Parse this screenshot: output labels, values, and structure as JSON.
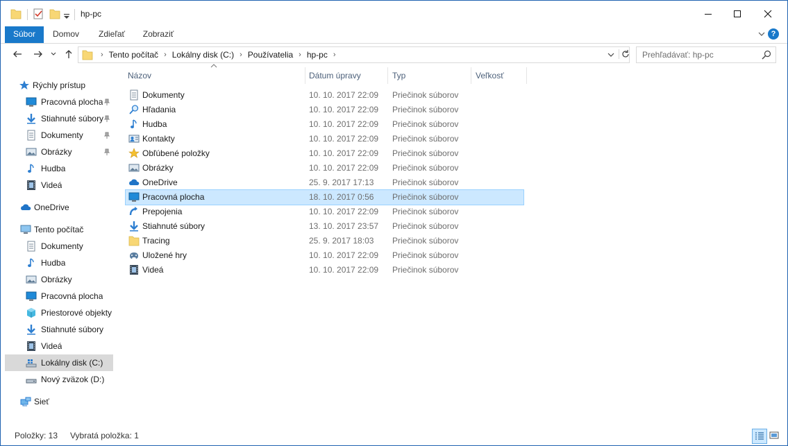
{
  "window": {
    "title": "hp-pc"
  },
  "ribbon": {
    "tabs": [
      {
        "label": "Súbor"
      },
      {
        "label": "Domov"
      },
      {
        "label": "Zdieľať"
      },
      {
        "label": "Zobraziť"
      }
    ]
  },
  "address": {
    "crumbs": [
      "Tento počítač",
      "Lokálny disk (C:)",
      "Používatelia",
      "hp-pc"
    ]
  },
  "search": {
    "placeholder": "Prehľadávať: hp-pc"
  },
  "nav": {
    "quick_access": "Rýchly prístup",
    "quick_items": [
      {
        "label": "Pracovná plocha",
        "icon": "desktop-icon"
      },
      {
        "label": "Stiahnuté súbory",
        "icon": "download-icon"
      },
      {
        "label": "Dokumenty",
        "icon": "documents-icon"
      },
      {
        "label": "Obrázky",
        "icon": "pictures-icon"
      },
      {
        "label": "Hudba",
        "icon": "music-icon"
      },
      {
        "label": "Videá",
        "icon": "videos-icon"
      }
    ],
    "onedrive": "OneDrive",
    "this_pc": "Tento počítač",
    "pc_items": [
      {
        "label": "Dokumenty"
      },
      {
        "label": "Hudba"
      },
      {
        "label": "Obrázky"
      },
      {
        "label": "Pracovná plocha"
      },
      {
        "label": "Priestorové objekty"
      },
      {
        "label": "Stiahnuté súbory"
      },
      {
        "label": "Videá"
      },
      {
        "label": "Lokálny disk (C:)"
      },
      {
        "label": "Nový zväzok (D:)"
      }
    ],
    "network": "Sieť"
  },
  "columns": {
    "name": "Názov",
    "date": "Dátum úpravy",
    "type": "Typ",
    "size": "Veľkosť"
  },
  "files": [
    {
      "name": "Dokumenty",
      "date": "10. 10. 2017 22:09",
      "type": "Priečinok súborov",
      "icon": "documents-icon"
    },
    {
      "name": "Hľadania",
      "date": "10. 10. 2017 22:09",
      "type": "Priečinok súborov",
      "icon": "search-folder-icon"
    },
    {
      "name": "Hudba",
      "date": "10. 10. 2017 22:09",
      "type": "Priečinok súborov",
      "icon": "music-icon"
    },
    {
      "name": "Kontakty",
      "date": "10. 10. 2017 22:09",
      "type": "Priečinok súborov",
      "icon": "contacts-icon"
    },
    {
      "name": "Obľúbené položky",
      "date": "10. 10. 2017 22:09",
      "type": "Priečinok súborov",
      "icon": "favorites-icon"
    },
    {
      "name": "Obrázky",
      "date": "10. 10. 2017 22:09",
      "type": "Priečinok súborov",
      "icon": "pictures-icon"
    },
    {
      "name": "OneDrive",
      "date": "25. 9. 2017 17:13",
      "type": "Priečinok súborov",
      "icon": "onedrive-icon"
    },
    {
      "name": "Pracovná plocha",
      "date": "18. 10. 2017 0:56",
      "type": "Priečinok súborov",
      "icon": "desktop-icon"
    },
    {
      "name": "Prepojenia",
      "date": "10. 10. 2017 22:09",
      "type": "Priečinok súborov",
      "icon": "links-icon"
    },
    {
      "name": "Stiahnuté súbory",
      "date": "13. 10. 2017 23:57",
      "type": "Priečinok súborov",
      "icon": "download-icon"
    },
    {
      "name": "Tracing",
      "date": "25. 9. 2017 18:03",
      "type": "Priečinok súborov",
      "icon": "folder-icon"
    },
    {
      "name": "Uložené hry",
      "date": "10. 10. 2017 22:09",
      "type": "Priečinok súborov",
      "icon": "saved-games-icon"
    },
    {
      "name": "Videá",
      "date": "10. 10. 2017 22:09",
      "type": "Priečinok súborov",
      "icon": "videos-icon"
    }
  ],
  "status": {
    "count": "Položky: 13",
    "selected": "Vybratá položka: 1"
  },
  "colors": {
    "accent": "#1979ca",
    "selection": "#cce8ff",
    "folder": "#f8d775"
  }
}
